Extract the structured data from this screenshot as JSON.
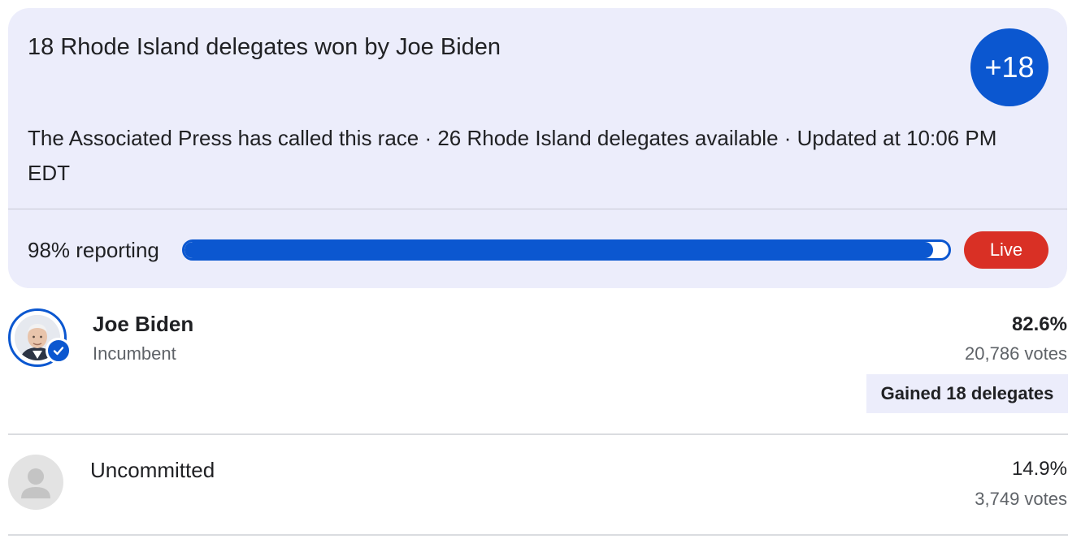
{
  "summary": {
    "headline": "18 Rhode Island delegates won by Joe Biden",
    "delegate_badge": "+18",
    "race_info": "The Associated Press has called this race · 26 Rhode Island delegates available · Updated at 10:06 PM EDT",
    "reporting_label": "98% reporting",
    "reporting_progress": 0.98,
    "live_label": "Live"
  },
  "candidates": [
    {
      "name": "Joe Biden",
      "subtitle": "Incumbent",
      "percent": "82.6%",
      "votes": "20,786 votes",
      "delegates_note": "Gained 18 delegates",
      "winner": true
    },
    {
      "name": "Uncommitted",
      "percent": "14.9%",
      "votes": "3,749 votes",
      "winner": false
    }
  ],
  "colors": {
    "accent": "#0b57d0",
    "live": "#d93025",
    "card_background": "#ecedfb"
  }
}
